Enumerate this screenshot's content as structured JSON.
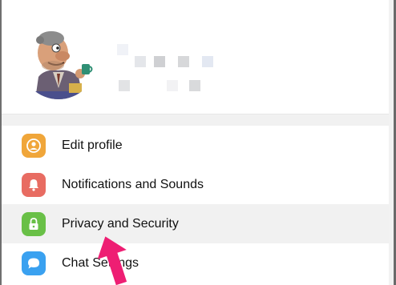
{
  "window": {
    "title": ""
  },
  "profile": {
    "avatar_alt": "avatar"
  },
  "menu": {
    "items": [
      {
        "label": "Edit profile",
        "icon": "user-icon",
        "color": "#F0A63A"
      },
      {
        "label": "Notifications and Sounds",
        "icon": "bell-icon",
        "color": "#E86C62"
      },
      {
        "label": "Privacy and Security",
        "icon": "lock-icon",
        "color": "#69C047"
      },
      {
        "label": "Chat Settings",
        "icon": "chat-bubble-icon",
        "color": "#3AA1F0"
      }
    ]
  },
  "colors": {
    "accent_arrow": "#EE1E73",
    "hover_bg": "#F1F1F1",
    "separator": "#F1F1F1"
  }
}
